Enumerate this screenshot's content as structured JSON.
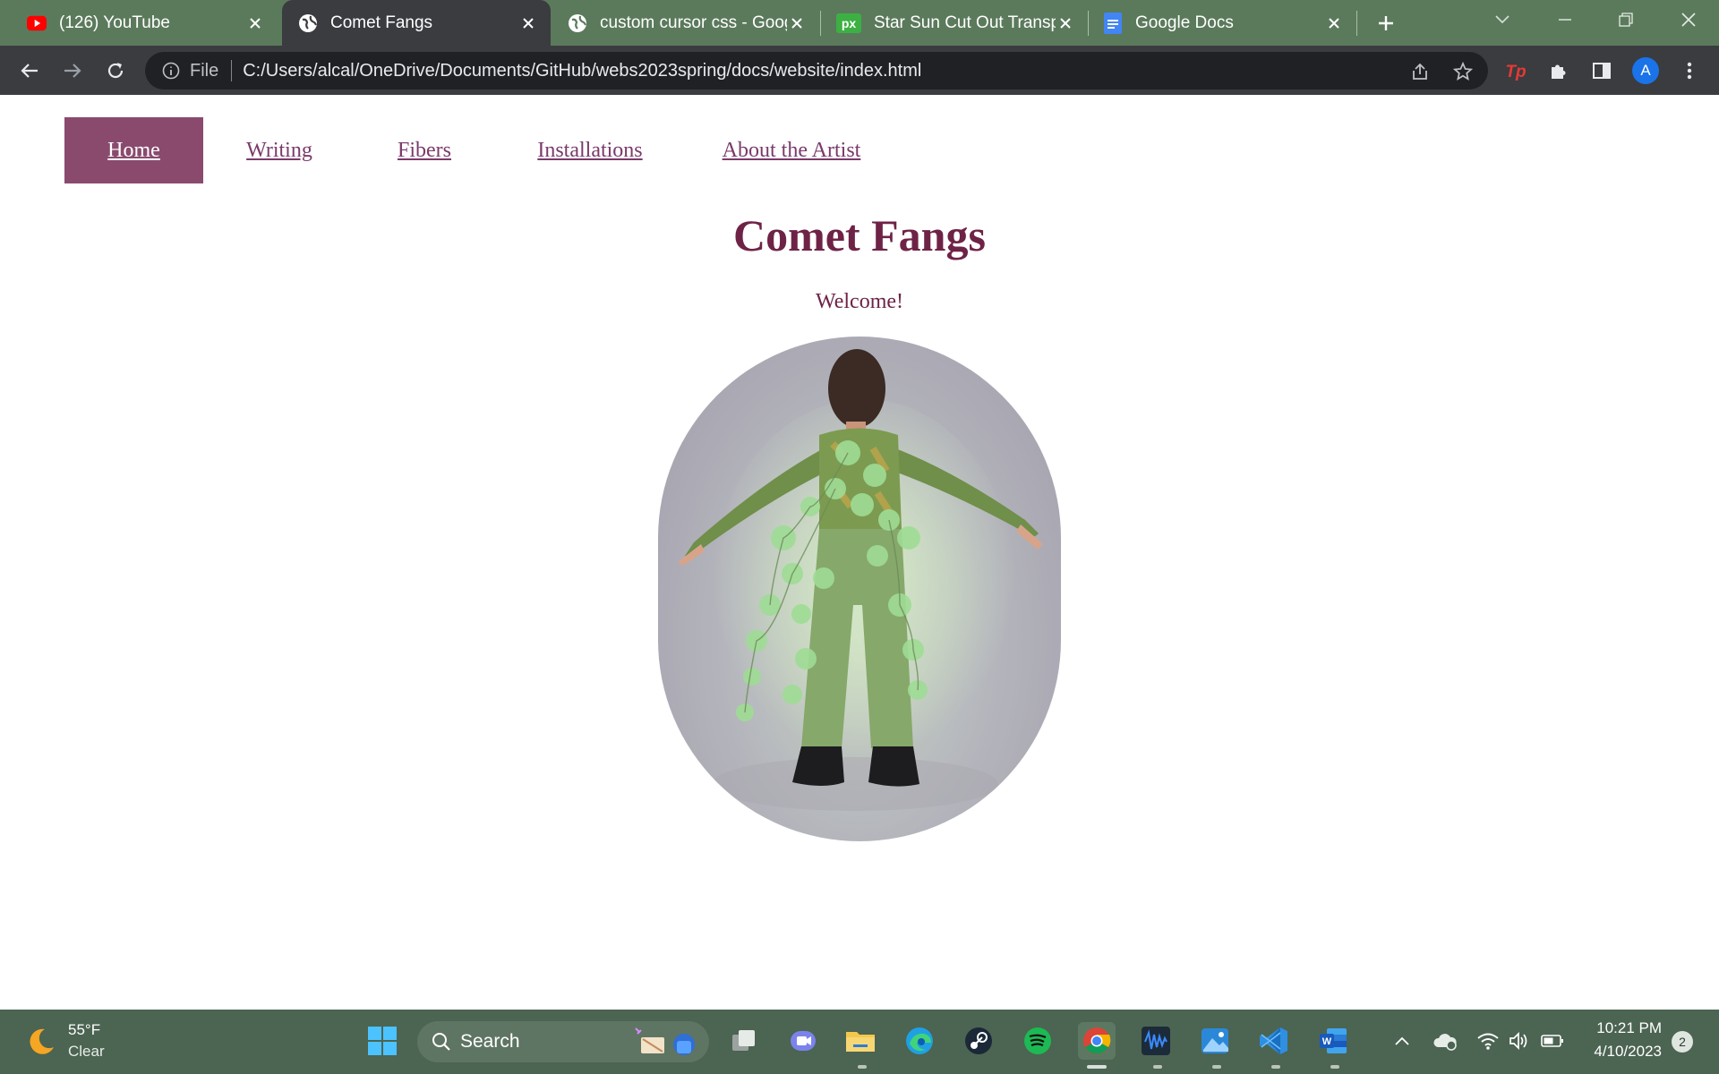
{
  "browser": {
    "tabs": [
      {
        "title": "(126) YouTube",
        "icon": "youtube-icon",
        "active": false
      },
      {
        "title": "Comet Fangs",
        "icon": "globe-icon",
        "active": true
      },
      {
        "title": "custom cursor css - Goog",
        "icon": "globe-icon",
        "active": false
      },
      {
        "title": "Star Sun Cut Out Transpar",
        "icon": "pixabay-icon",
        "active": false
      },
      {
        "title": "Google Docs",
        "icon": "google-docs-icon",
        "active": false
      }
    ],
    "omnibox": {
      "scheme_label": "File",
      "url": "C:/Users/alcal/OneDrive/Documents/GitHub/webs2023spring/docs/website/index.html"
    },
    "profile_initial": "A"
  },
  "page": {
    "nav": [
      {
        "label": "Home",
        "active": true
      },
      {
        "label": "Writing",
        "active": false
      },
      {
        "label": "Fibers",
        "active": false
      },
      {
        "label": "Installations",
        "active": false
      },
      {
        "label": "About the Artist",
        "active": false
      }
    ],
    "title": "Comet Fangs",
    "welcome": "Welcome!"
  },
  "taskbar": {
    "weather": {
      "temp": "55°F",
      "condition": "Clear"
    },
    "search_label": "Search",
    "time": "10:21 PM",
    "date": "4/10/2023",
    "notifications": "2"
  },
  "colors": {
    "nav_active_bg": "#8a4a6e",
    "link": "#7a3a6a",
    "title": "#6e2346",
    "tab_strip": "#5b7a5c",
    "taskbar": "#4c6452"
  }
}
